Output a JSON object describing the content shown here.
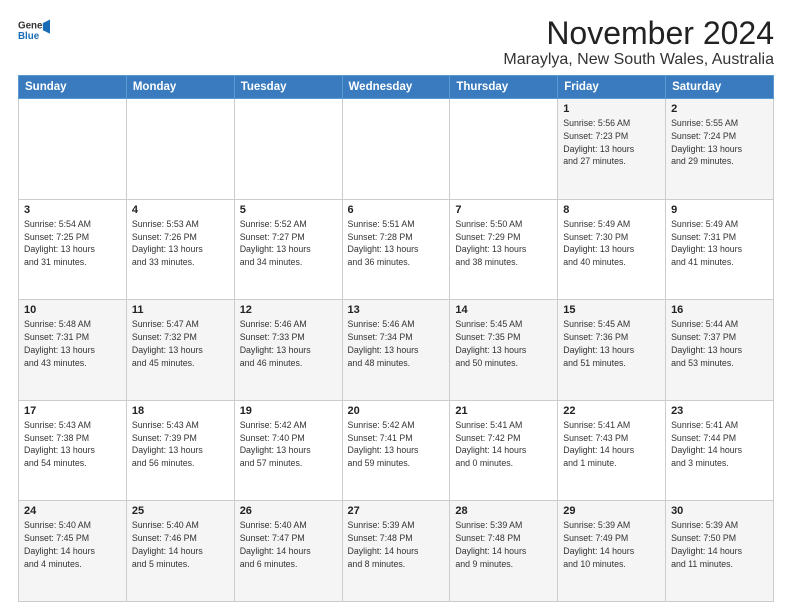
{
  "header": {
    "logo_line1": "General",
    "logo_line2": "Blue",
    "month_title": "November 2024",
    "location": "Maraylya, New South Wales, Australia"
  },
  "weekdays": [
    "Sunday",
    "Monday",
    "Tuesday",
    "Wednesday",
    "Thursday",
    "Friday",
    "Saturday"
  ],
  "weeks": [
    [
      {
        "day": "",
        "info": ""
      },
      {
        "day": "",
        "info": ""
      },
      {
        "day": "",
        "info": ""
      },
      {
        "day": "",
        "info": ""
      },
      {
        "day": "",
        "info": ""
      },
      {
        "day": "1",
        "info": "Sunrise: 5:56 AM\nSunset: 7:23 PM\nDaylight: 13 hours\nand 27 minutes."
      },
      {
        "day": "2",
        "info": "Sunrise: 5:55 AM\nSunset: 7:24 PM\nDaylight: 13 hours\nand 29 minutes."
      }
    ],
    [
      {
        "day": "3",
        "info": "Sunrise: 5:54 AM\nSunset: 7:25 PM\nDaylight: 13 hours\nand 31 minutes."
      },
      {
        "day": "4",
        "info": "Sunrise: 5:53 AM\nSunset: 7:26 PM\nDaylight: 13 hours\nand 33 minutes."
      },
      {
        "day": "5",
        "info": "Sunrise: 5:52 AM\nSunset: 7:27 PM\nDaylight: 13 hours\nand 34 minutes."
      },
      {
        "day": "6",
        "info": "Sunrise: 5:51 AM\nSunset: 7:28 PM\nDaylight: 13 hours\nand 36 minutes."
      },
      {
        "day": "7",
        "info": "Sunrise: 5:50 AM\nSunset: 7:29 PM\nDaylight: 13 hours\nand 38 minutes."
      },
      {
        "day": "8",
        "info": "Sunrise: 5:49 AM\nSunset: 7:30 PM\nDaylight: 13 hours\nand 40 minutes."
      },
      {
        "day": "9",
        "info": "Sunrise: 5:49 AM\nSunset: 7:31 PM\nDaylight: 13 hours\nand 41 minutes."
      }
    ],
    [
      {
        "day": "10",
        "info": "Sunrise: 5:48 AM\nSunset: 7:31 PM\nDaylight: 13 hours\nand 43 minutes."
      },
      {
        "day": "11",
        "info": "Sunrise: 5:47 AM\nSunset: 7:32 PM\nDaylight: 13 hours\nand 45 minutes."
      },
      {
        "day": "12",
        "info": "Sunrise: 5:46 AM\nSunset: 7:33 PM\nDaylight: 13 hours\nand 46 minutes."
      },
      {
        "day": "13",
        "info": "Sunrise: 5:46 AM\nSunset: 7:34 PM\nDaylight: 13 hours\nand 48 minutes."
      },
      {
        "day": "14",
        "info": "Sunrise: 5:45 AM\nSunset: 7:35 PM\nDaylight: 13 hours\nand 50 minutes."
      },
      {
        "day": "15",
        "info": "Sunrise: 5:45 AM\nSunset: 7:36 PM\nDaylight: 13 hours\nand 51 minutes."
      },
      {
        "day": "16",
        "info": "Sunrise: 5:44 AM\nSunset: 7:37 PM\nDaylight: 13 hours\nand 53 minutes."
      }
    ],
    [
      {
        "day": "17",
        "info": "Sunrise: 5:43 AM\nSunset: 7:38 PM\nDaylight: 13 hours\nand 54 minutes."
      },
      {
        "day": "18",
        "info": "Sunrise: 5:43 AM\nSunset: 7:39 PM\nDaylight: 13 hours\nand 56 minutes."
      },
      {
        "day": "19",
        "info": "Sunrise: 5:42 AM\nSunset: 7:40 PM\nDaylight: 13 hours\nand 57 minutes."
      },
      {
        "day": "20",
        "info": "Sunrise: 5:42 AM\nSunset: 7:41 PM\nDaylight: 13 hours\nand 59 minutes."
      },
      {
        "day": "21",
        "info": "Sunrise: 5:41 AM\nSunset: 7:42 PM\nDaylight: 14 hours\nand 0 minutes."
      },
      {
        "day": "22",
        "info": "Sunrise: 5:41 AM\nSunset: 7:43 PM\nDaylight: 14 hours\nand 1 minute."
      },
      {
        "day": "23",
        "info": "Sunrise: 5:41 AM\nSunset: 7:44 PM\nDaylight: 14 hours\nand 3 minutes."
      }
    ],
    [
      {
        "day": "24",
        "info": "Sunrise: 5:40 AM\nSunset: 7:45 PM\nDaylight: 14 hours\nand 4 minutes."
      },
      {
        "day": "25",
        "info": "Sunrise: 5:40 AM\nSunset: 7:46 PM\nDaylight: 14 hours\nand 5 minutes."
      },
      {
        "day": "26",
        "info": "Sunrise: 5:40 AM\nSunset: 7:47 PM\nDaylight: 14 hours\nand 6 minutes."
      },
      {
        "day": "27",
        "info": "Sunrise: 5:39 AM\nSunset: 7:48 PM\nDaylight: 14 hours\nand 8 minutes."
      },
      {
        "day": "28",
        "info": "Sunrise: 5:39 AM\nSunset: 7:48 PM\nDaylight: 14 hours\nand 9 minutes."
      },
      {
        "day": "29",
        "info": "Sunrise: 5:39 AM\nSunset: 7:49 PM\nDaylight: 14 hours\nand 10 minutes."
      },
      {
        "day": "30",
        "info": "Sunrise: 5:39 AM\nSunset: 7:50 PM\nDaylight: 14 hours\nand 11 minutes."
      }
    ]
  ]
}
